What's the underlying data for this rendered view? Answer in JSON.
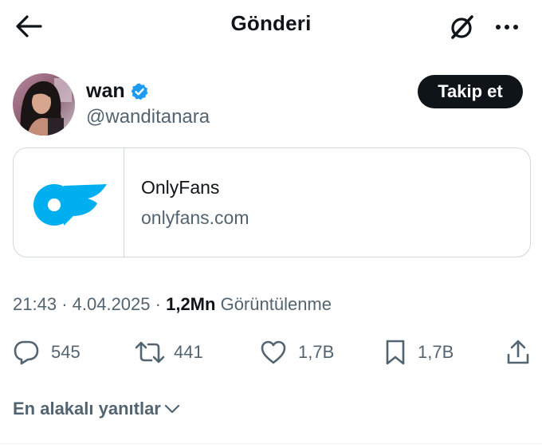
{
  "header": {
    "title": "Gönderi",
    "back_icon": "arrow-left-icon",
    "grok_icon": "grok-icon",
    "more_icon": "more-horizontal-icon"
  },
  "author": {
    "name": "wan",
    "handle": "@wanditanara",
    "verified": true,
    "verified_color": "#1d9bf0",
    "follow_label": "Takip et"
  },
  "card": {
    "title": "OnlyFans",
    "domain": "onlyfans.com",
    "logo_color": "#00aff0"
  },
  "meta": {
    "time": "21:43",
    "date": "4.04.2025",
    "views_count": "1,2Mn",
    "views_label": "Görüntülenme"
  },
  "actions": {
    "replies": "545",
    "reposts": "441",
    "likes": "1,7B",
    "bookmarks": "1,7B"
  },
  "replies_sort": {
    "label": "En alakalı yanıtlar"
  }
}
